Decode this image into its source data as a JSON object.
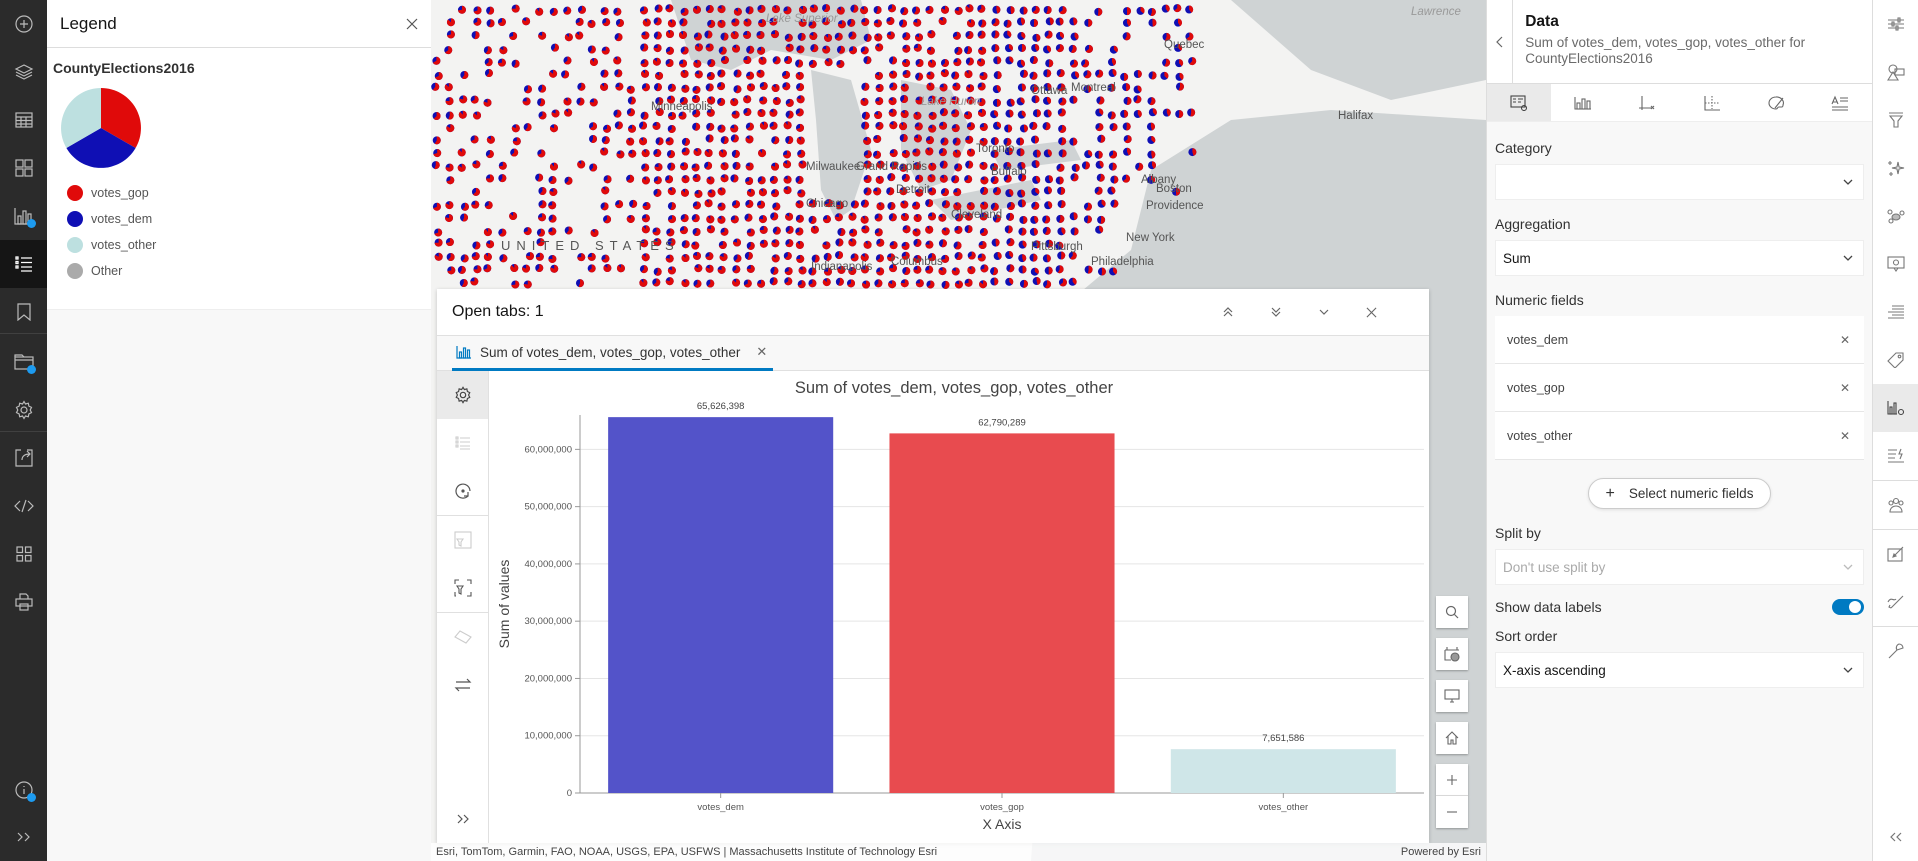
{
  "left_rail": {
    "items": [
      {
        "icon": "add-icon"
      },
      {
        "icon": "layers-icon"
      },
      {
        "icon": "table-icon"
      },
      {
        "icon": "dashboard-icon"
      },
      {
        "icon": "chart-icon",
        "badge": true
      },
      {
        "icon": "legend-icon",
        "active": true
      },
      {
        "icon": "bookmark-icon"
      },
      {
        "icon": "folder-icon",
        "badge": true
      },
      {
        "icon": "settings-icon"
      },
      {
        "icon": "share-icon"
      },
      {
        "icon": "embed-icon"
      },
      {
        "icon": "apps-icon"
      },
      {
        "icon": "print-icon"
      },
      {
        "icon": "info-icon",
        "badge": true
      },
      {
        "icon": "expand-icon"
      }
    ]
  },
  "legend": {
    "title": "Legend",
    "layer_name": "CountyElections2016",
    "items": [
      {
        "label": "votes_gop",
        "color": "#e00a0a"
      },
      {
        "label": "votes_dem",
        "color": "#0f0fb4"
      },
      {
        "label": "votes_other",
        "color": "#bde0e0"
      },
      {
        "label": "Other",
        "color": "#aaaaaa"
      }
    ]
  },
  "map": {
    "labels": [
      "Lake Superior",
      "Lake Huron",
      "Minneapolis",
      "Milwaukee",
      "Grand Rapids",
      "Detroit",
      "Chicago",
      "Toronto",
      "Buffalo",
      "Cleveland",
      "Pittsburgh",
      "Columbus",
      "Indianapolis",
      "Albany",
      "Boston",
      "Providence",
      "New York",
      "Philadelphia",
      "Ottawa",
      "Montreal",
      "Quebec",
      "Halifax",
      "Lawrence",
      "UNITED STATES"
    ],
    "attribution": "Esri, TomTom, Garmin, FAO, NOAA, USGS, EPA, USFWS | Massachusetts Institute of Technology Esri",
    "powered_by": "Powered by Esri"
  },
  "chart_panel": {
    "title": "Open tabs: 1",
    "tab_label": "Sum of votes_dem, votes_gop, votes_other"
  },
  "chart_data": {
    "type": "bar",
    "title": "Sum of votes_dem, votes_gop, votes_other",
    "xlabel": "X Axis",
    "ylabel": "Sum of values",
    "categories": [
      "votes_dem",
      "votes_gop",
      "votes_other"
    ],
    "values": [
      65626398,
      62790289,
      7651586
    ],
    "data_labels": [
      "65,626,398",
      "62,790,289",
      "7,651,586"
    ],
    "colors": [
      "#5353c9",
      "#e84b4f",
      "#cfe6e8"
    ],
    "ylim": [
      0,
      66000000
    ],
    "yticks": [
      0,
      10000000,
      20000000,
      30000000,
      40000000,
      50000000,
      60000000
    ],
    "ytick_labels": [
      "0",
      "10,000,000",
      "20,000,000",
      "30,000,000",
      "40,000,000",
      "50,000,000",
      "60,000,000"
    ],
    "grid": true,
    "legend": "none"
  },
  "right_panel": {
    "title": "Data",
    "subtitle": "Sum of votes_dem, votes_gop, votes_other for CountyElections2016",
    "category_label": "Category",
    "category_value": "",
    "aggregation_label": "Aggregation",
    "aggregation_value": "Sum",
    "numeric_fields_label": "Numeric fields",
    "numeric_fields": [
      "votes_dem",
      "votes_gop",
      "votes_other"
    ],
    "select_fields_button": "Select numeric fields",
    "split_by_label": "Split by",
    "split_by_placeholder": "Don't use split by",
    "show_data_labels_label": "Show data labels",
    "show_data_labels": true,
    "sort_order_label": "Sort order",
    "sort_order_value": "X-axis ascending"
  },
  "colors": {
    "accent": "#007ac2",
    "badge": "#1d9bf0"
  }
}
